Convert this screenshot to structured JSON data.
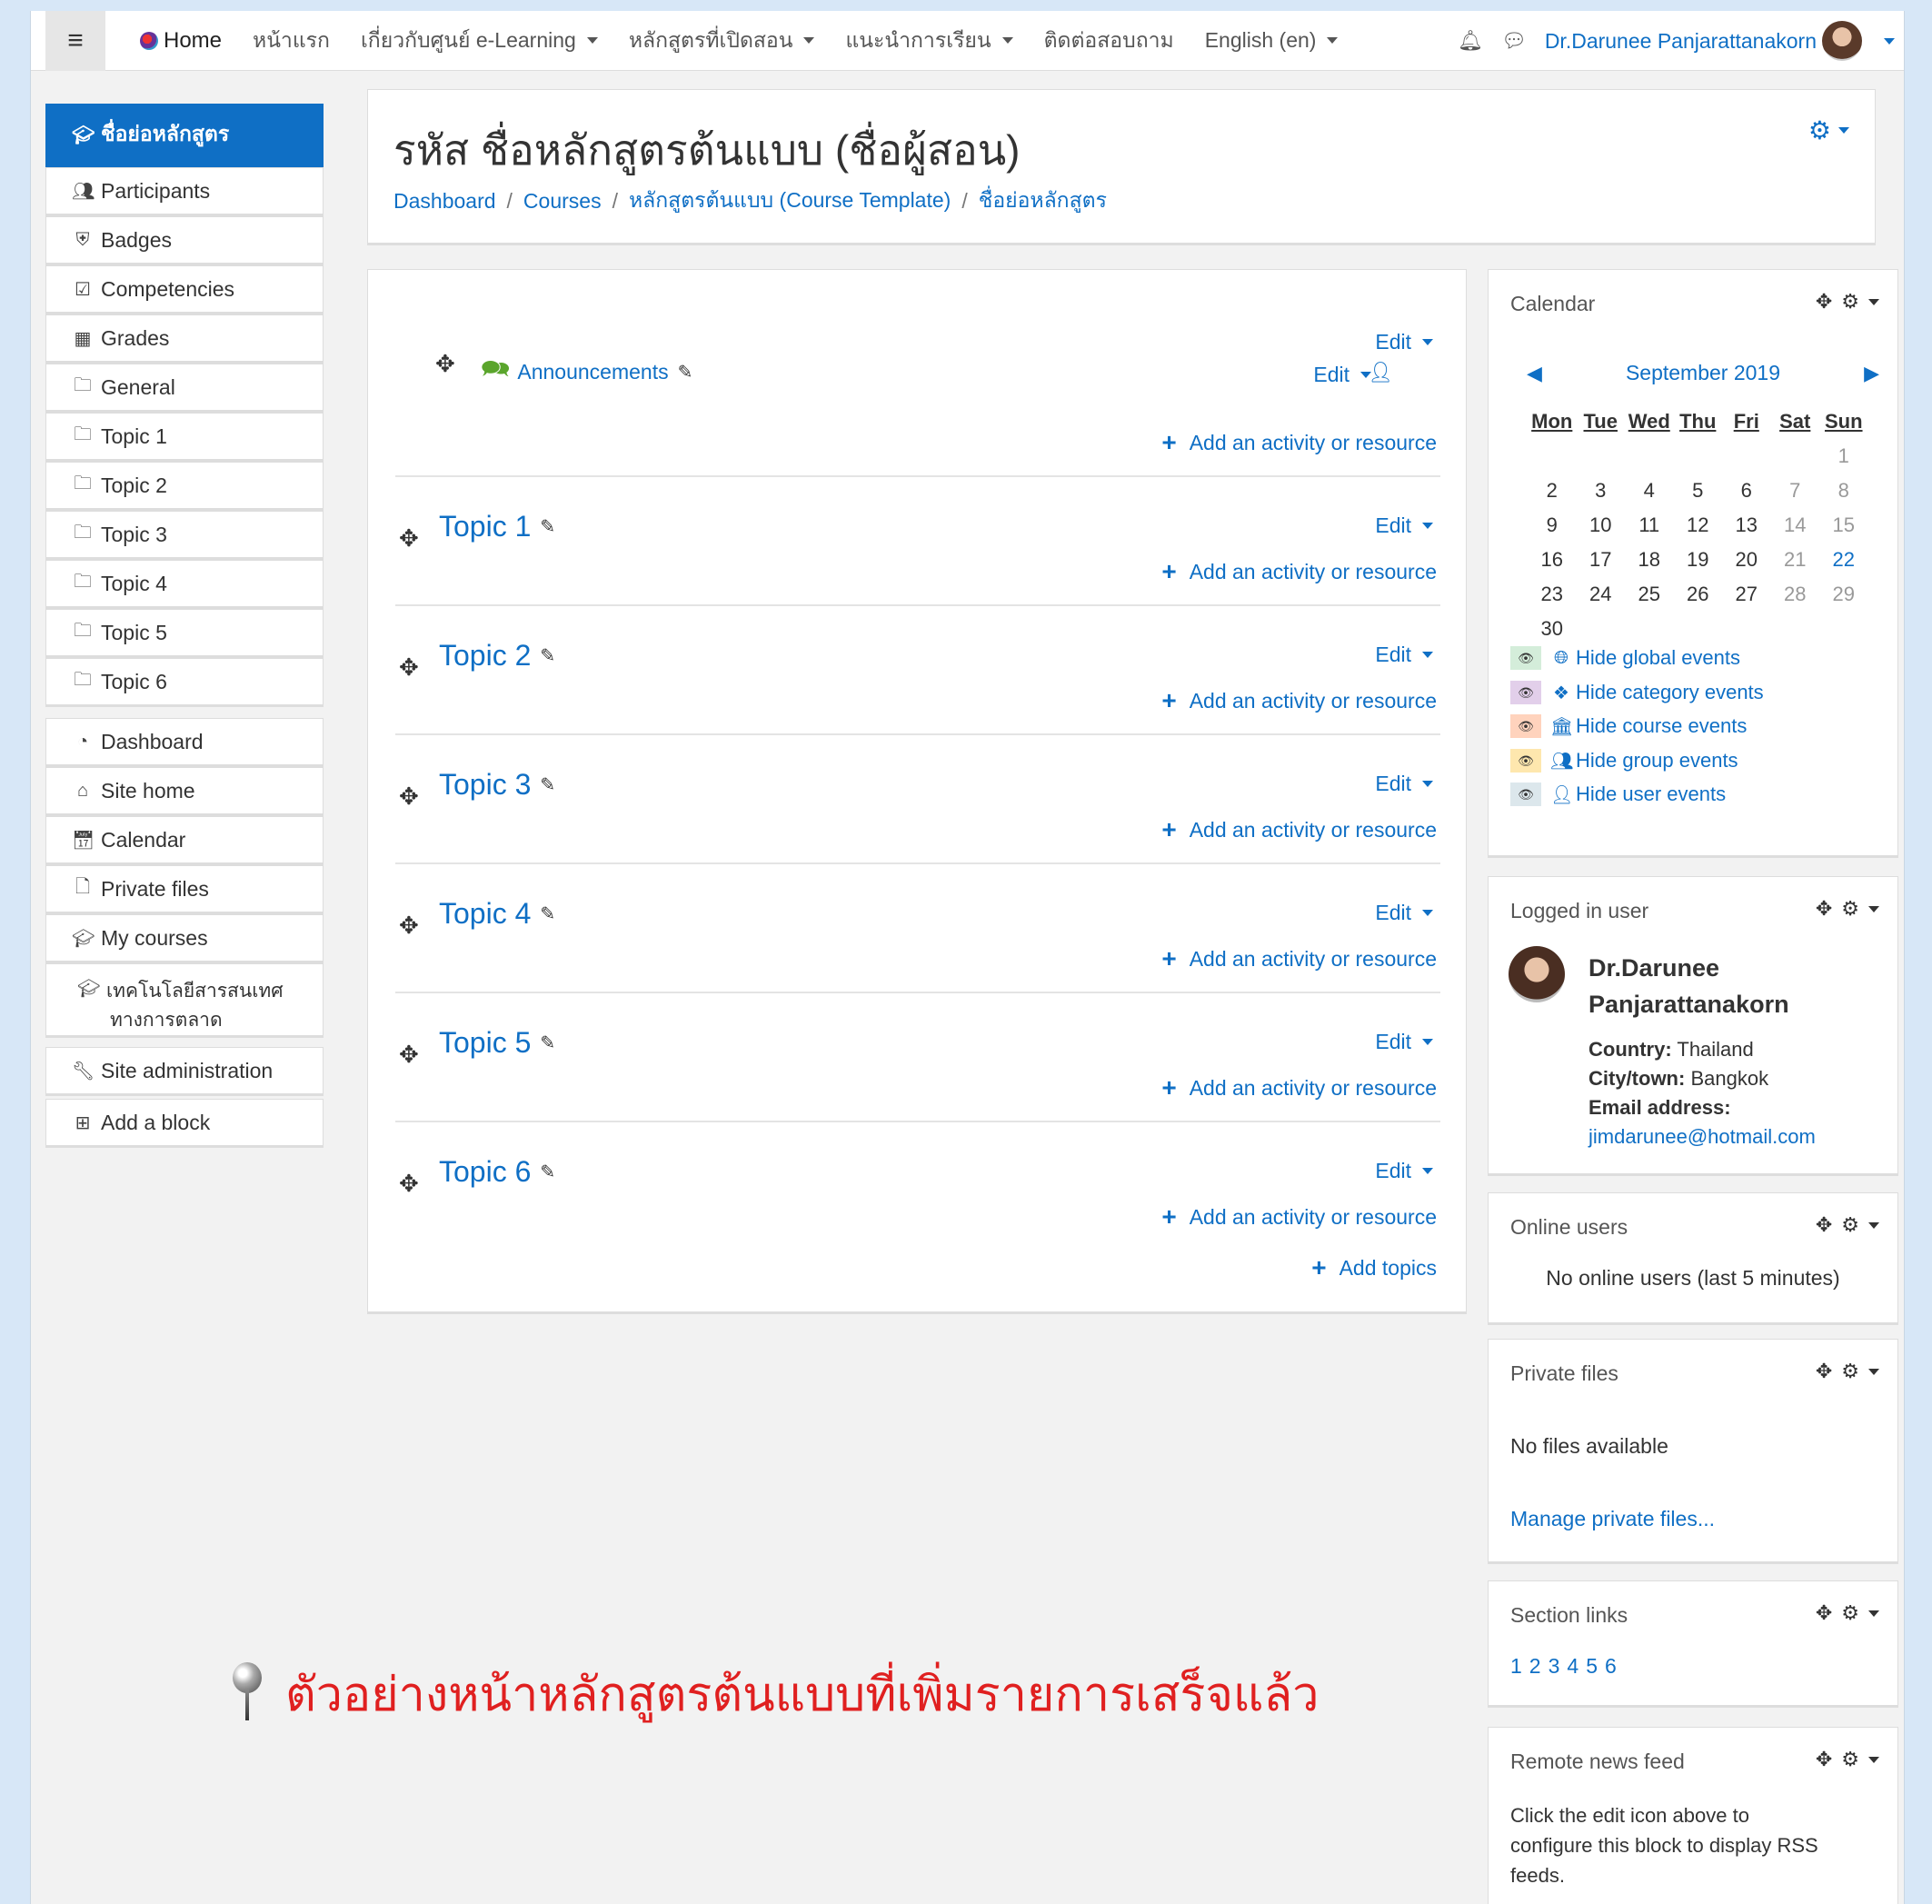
{
  "navbar": {
    "home": "Home",
    "items": [
      {
        "label": "หน้าแรก",
        "dropdown": false
      },
      {
        "label": "เกี่ยวกับศูนย์ e-Learning",
        "dropdown": true
      },
      {
        "label": "หลักสูตรที่เปิดสอน",
        "dropdown": true
      },
      {
        "label": "แนะนำการเรียน",
        "dropdown": true
      },
      {
        "label": "ติดต่อสอบถาม",
        "dropdown": false
      },
      {
        "label": "English (en)",
        "dropdown": true
      }
    ],
    "user_name": "Dr.Darunee Panjarattanakorn"
  },
  "drawer": {
    "course_short": "ชื่อย่อหลักสูตร",
    "participants": "Participants",
    "badges": "Badges",
    "competencies": "Competencies",
    "grades": "Grades",
    "general": "General",
    "topic1": "Topic 1",
    "topic2": "Topic 2",
    "topic3": "Topic 3",
    "topic4": "Topic 4",
    "topic5": "Topic 5",
    "topic6": "Topic 6",
    "dashboard": "Dashboard",
    "site_home": "Site home",
    "calendar": "Calendar",
    "private_files": "Private files",
    "my_courses": "My courses",
    "course_line1": "เทคโนโลยีสารสนเทศ",
    "course_line2": "ทางการตลาด",
    "site_admin": "Site administration",
    "add_block": "Add a block"
  },
  "header": {
    "title": "รหัส ชื่อหลักสูตรต้นแบบ (ชื่อผู้สอน)",
    "breadcrumb": [
      "Dashboard",
      "Courses",
      "หลักสูตรต้นแบบ (Course Template)",
      "ชื่อย่อหลักสูตร"
    ]
  },
  "course": {
    "edit": "Edit",
    "add_activity": "Add an activity or resource",
    "announcements": "Announcements",
    "topics": [
      "Topic 1",
      "Topic 2",
      "Topic 3",
      "Topic 4",
      "Topic 5",
      "Topic 6"
    ],
    "add_topics": "Add topics"
  },
  "calendar": {
    "title": "Calendar",
    "month": "September 2019",
    "dow": [
      "Mon",
      "Tue",
      "Wed",
      "Thu",
      "Fri",
      "Sat",
      "Sun"
    ],
    "weeks": [
      [
        "",
        "",
        "",
        "",
        "",
        "",
        "1"
      ],
      [
        "2",
        "3",
        "4",
        "5",
        "6",
        "7",
        "8"
      ],
      [
        "9",
        "10",
        "11",
        "12",
        "13",
        "14",
        "15"
      ],
      [
        "16",
        "17",
        "18",
        "19",
        "20",
        "21",
        "22"
      ],
      [
        "23",
        "24",
        "25",
        "26",
        "27",
        "28",
        "29"
      ],
      [
        "30",
        "",
        "",
        "",
        "",
        "",
        ""
      ]
    ],
    "today": "22",
    "events": [
      {
        "label": "Hide global events",
        "color": "#d4edda"
      },
      {
        "label": "Hide category events",
        "color": "#e2cfea"
      },
      {
        "label": "Hide course events",
        "color": "#ffd3bd"
      },
      {
        "label": "Hide group events",
        "color": "#fee7ae"
      },
      {
        "label": "Hide user events",
        "color": "#dce7ec"
      }
    ]
  },
  "logged_in": {
    "title": "Logged in user",
    "name_line1": "Dr.Darunee",
    "name_line2": "Panjarattanakorn",
    "country_label": "Country:",
    "country": "Thailand",
    "city_label": "City/town:",
    "city": "Bangkok",
    "email_label": "Email address:",
    "email": "jimdarunee@hotmail.com"
  },
  "online_users": {
    "title": "Online users",
    "text": "No online users (last 5 minutes)"
  },
  "private_files": {
    "title": "Private files",
    "text": "No files available",
    "manage": "Manage private files..."
  },
  "section_links": {
    "title": "Section links",
    "links": [
      "1",
      "2",
      "3",
      "4",
      "5",
      "6"
    ]
  },
  "news_feed": {
    "title": "Remote news feed",
    "line1": "Click the edit icon above to",
    "line2": "configure this block to display RSS",
    "line3": "feeds."
  },
  "annotation": "ตัวอย่างหน้าหลักสูตรต้นแบบที่เพิ่มรายการเสร็จแล้ว",
  "colors": {
    "accent": "#0f6fc5",
    "annotation": "#e02020"
  }
}
